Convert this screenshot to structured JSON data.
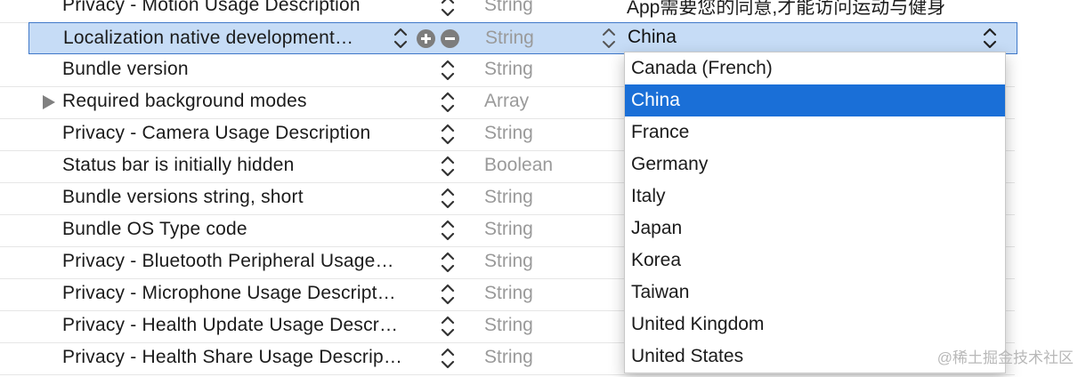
{
  "rows": [
    {
      "key": "Privacy - Motion Usage Description",
      "type": "String",
      "value": "App需要您的同意,才能访问运动与健身"
    },
    {
      "key": "Localization native development…",
      "type": "String",
      "value": "China"
    },
    {
      "key": "Bundle version",
      "type": "String",
      "value": ""
    },
    {
      "key": "Required background modes",
      "type": "Array",
      "value": ""
    },
    {
      "key": "Privacy - Camera Usage Description",
      "type": "String",
      "value": ""
    },
    {
      "key": "Status bar is initially hidden",
      "type": "Boolean",
      "value": ""
    },
    {
      "key": "Bundle versions string, short",
      "type": "String",
      "value": ""
    },
    {
      "key": "Bundle OS Type code",
      "type": "String",
      "value": ""
    },
    {
      "key": "Privacy - Bluetooth Peripheral Usage…",
      "type": "String",
      "value": ""
    },
    {
      "key": "Privacy - Microphone Usage Descript…",
      "type": "String",
      "value": ""
    },
    {
      "key": "Privacy - Health Update Usage Descr…",
      "type": "String",
      "value": ""
    },
    {
      "key": "Privacy - Health Share Usage Descrip…",
      "type": "String",
      "value": ""
    }
  ],
  "menu": {
    "options": [
      "Canada (French)",
      "China",
      "France",
      "Germany",
      "Italy",
      "Japan",
      "Korea",
      "Taiwan",
      "United Kingdom",
      "United States"
    ],
    "selected": "China"
  },
  "watermark": "@稀土掘金技术社区",
  "colors": {
    "selection_row": "#c6dcf6",
    "menu_highlight": "#1a6fd7",
    "type_text": "#9a9a9a"
  }
}
